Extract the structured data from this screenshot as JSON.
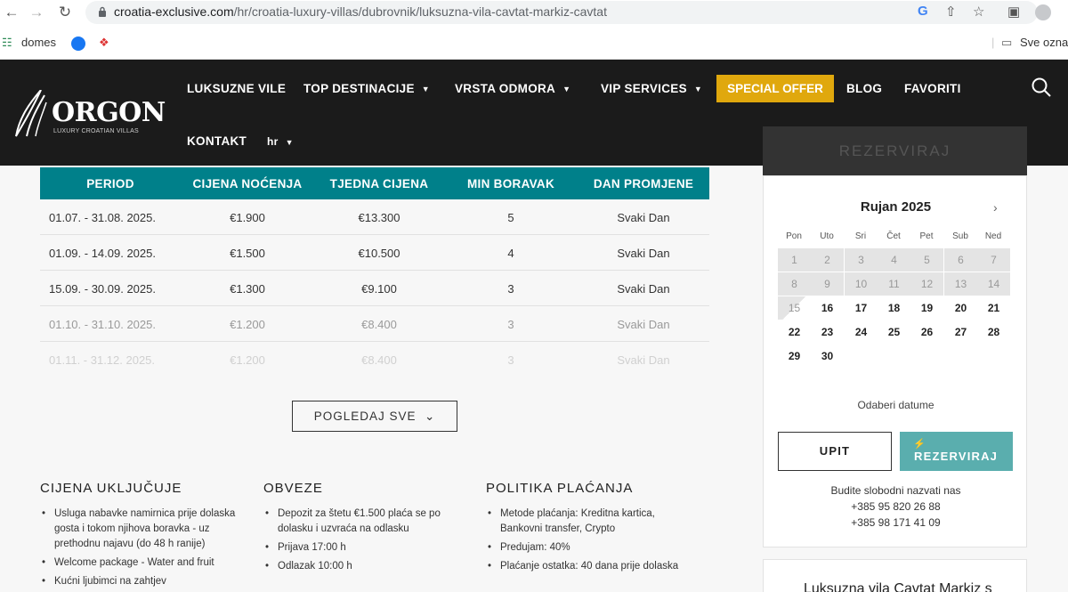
{
  "browser": {
    "url_host": "croatia-exclusive.com",
    "url_path": "/hr/croatia-luxury-villas/dubrovnik/luksuzna-vila-cavtat-markiz-cavtat",
    "bookmarks": [
      "domes"
    ],
    "bookmarks_right": "Sve ozna"
  },
  "site": {
    "logo_text": "ORGON",
    "logo_sub": "LUXURY CROATIAN VILLAS",
    "menu": {
      "vile": "LUKSUZNE VILE",
      "destinacije": "TOP DESTINACIJE",
      "vrsta": "VRSTA ODMORA",
      "vip": "VIP SERVICES",
      "special": "SPECIAL OFFER",
      "blog": "BLOG",
      "favoriti": "FAVORITI",
      "kontakt": "KONTAKT",
      "lang": "hr"
    }
  },
  "prices": {
    "headers": [
      "PERIOD",
      "CIJENA NOĆENJA",
      "TJEDNA CIJENA",
      "MIN BORAVAK",
      "DAN PROMJENE"
    ],
    "rows": [
      [
        "01.07. - 31.08. 2025.",
        "€1.900",
        "€13.300",
        "5",
        "Svaki Dan"
      ],
      [
        "01.09. - 14.09. 2025.",
        "€1.500",
        "€10.500",
        "4",
        "Svaki Dan"
      ],
      [
        "15.09. - 30.09. 2025.",
        "€1.300",
        "€9.100",
        "3",
        "Svaki Dan"
      ],
      [
        "01.10. - 31.10. 2025.",
        "€1.200",
        "€8.400",
        "3",
        "Svaki Dan"
      ],
      [
        "01.11. - 31.12. 2025.",
        "€1.200",
        "€8.400",
        "3",
        "Svaki Dan"
      ]
    ],
    "view_all": "POGLEDAJ SVE"
  },
  "info": {
    "includes": {
      "title": "CIJENA UKLJUČUJE",
      "items": [
        "Usluga nabavke namirnica prije dolaska gosta i tokom njihova boravka - uz prethodnu najavu (do 48 h ranije)",
        "Welcome package - Water and fruit",
        "Kućni ljubimci na zahtjev"
      ]
    },
    "obligations": {
      "title": "OBVEZE",
      "items": [
        "Depozit za štetu €1.500 plaća se po dolasku i uzvraća na odlasku",
        "Prijava 17:00 h",
        "Odlazak 10:00 h"
      ]
    },
    "payment": {
      "title": "POLITIKA PLAĆANJA",
      "items": [
        "Metode plaćanja: Kreditna kartica, Bankovni transfer, Crypto",
        "Predujam: 40%",
        "Plaćanje ostatka: 40 dana prije dolaska"
      ]
    }
  },
  "booking": {
    "header": "REZERVIRAJ",
    "month": "Rujan 2025",
    "weekdays": [
      "Pon",
      "Uto",
      "Sri",
      "Čet",
      "Pet",
      "Sub",
      "Ned"
    ],
    "pick_label": "Odaberi datume",
    "upit": "UPIT",
    "rezerviraj": "REZERVIRAJ",
    "contact_line": "Budite slobodni nazvati nas",
    "phone1": "+385 95 820 26 88",
    "phone2": "+385 98 171 41 09"
  },
  "villa_title": "Luksuzna vila Cavtat Markiz s"
}
